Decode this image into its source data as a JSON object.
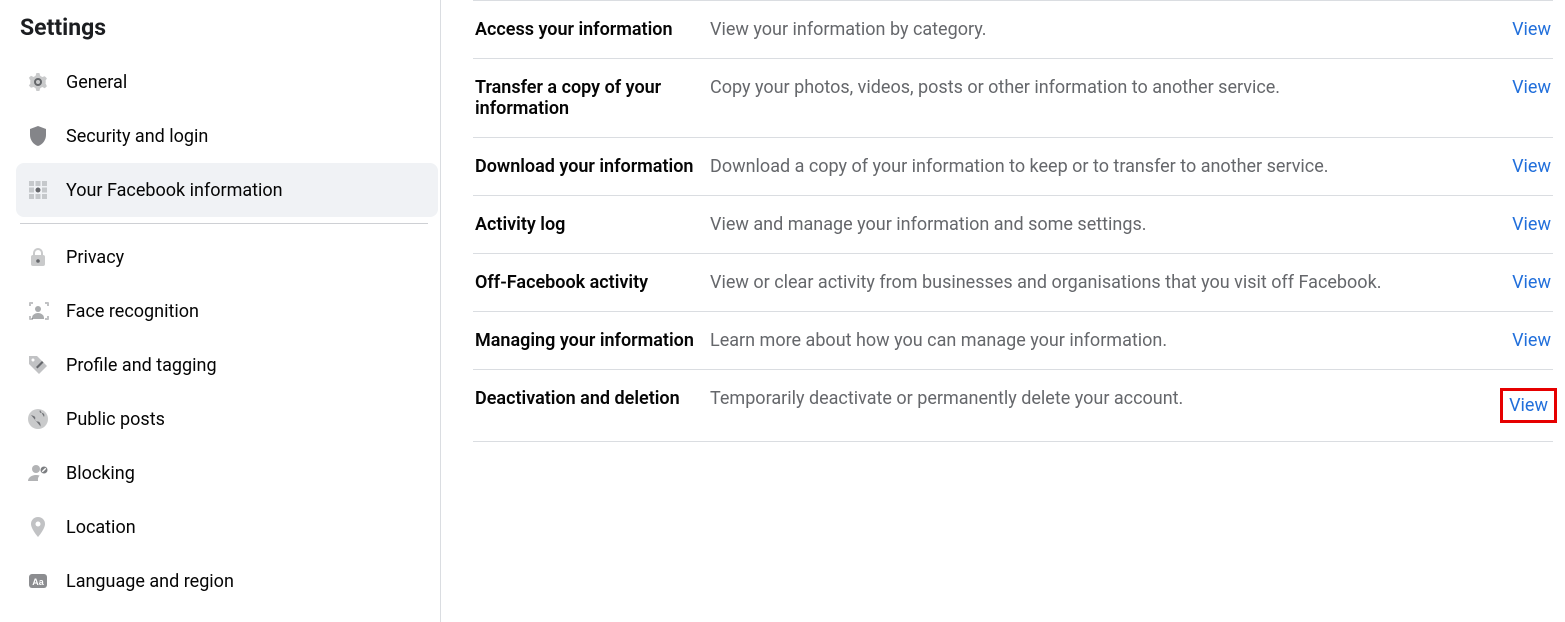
{
  "sidebar": {
    "title": "Settings",
    "items": [
      {
        "label": "General",
        "icon": "gear-icon",
        "selected": false
      },
      {
        "label": "Security and login",
        "icon": "shield-icon",
        "selected": false
      },
      {
        "label": "Your Facebook information",
        "icon": "grid-icon",
        "selected": true
      },
      {
        "label": "Privacy",
        "icon": "lock-icon",
        "selected": false
      },
      {
        "label": "Face recognition",
        "icon": "face-icon",
        "selected": false
      },
      {
        "label": "Profile and tagging",
        "icon": "tag-icon",
        "selected": false
      },
      {
        "label": "Public posts",
        "icon": "globe-icon",
        "selected": false
      },
      {
        "label": "Blocking",
        "icon": "block-icon",
        "selected": false
      },
      {
        "label": "Location",
        "icon": "location-icon",
        "selected": false
      },
      {
        "label": "Language and region",
        "icon": "language-icon",
        "selected": false
      }
    ],
    "dividerAfter": 2
  },
  "main": {
    "rows": [
      {
        "title": "Access your information",
        "desc": "View your information by category.",
        "action": "View",
        "highlight": false
      },
      {
        "title": "Transfer a copy of your information",
        "desc": "Copy your photos, videos, posts or other information to another service.",
        "action": "View",
        "highlight": false
      },
      {
        "title": "Download your information",
        "desc": "Download a copy of your information to keep or to transfer to another service.",
        "action": "View",
        "highlight": false
      },
      {
        "title": "Activity log",
        "desc": "View and manage your information and some settings.",
        "action": "View",
        "highlight": false
      },
      {
        "title": "Off-Facebook activity",
        "desc": "View or clear activity from businesses and organisations that you visit off Facebook.",
        "action": "View",
        "highlight": false
      },
      {
        "title": "Managing your information",
        "desc": "Learn more about how you can manage your information.",
        "action": "View",
        "highlight": false
      },
      {
        "title": "Deactivation and deletion",
        "desc": "Temporarily deactivate or permanently delete your account.",
        "action": "View",
        "highlight": true
      }
    ]
  },
  "colors": {
    "link": "#216fdb",
    "highlightBorder": "#e60000",
    "muted": "#65676b"
  }
}
